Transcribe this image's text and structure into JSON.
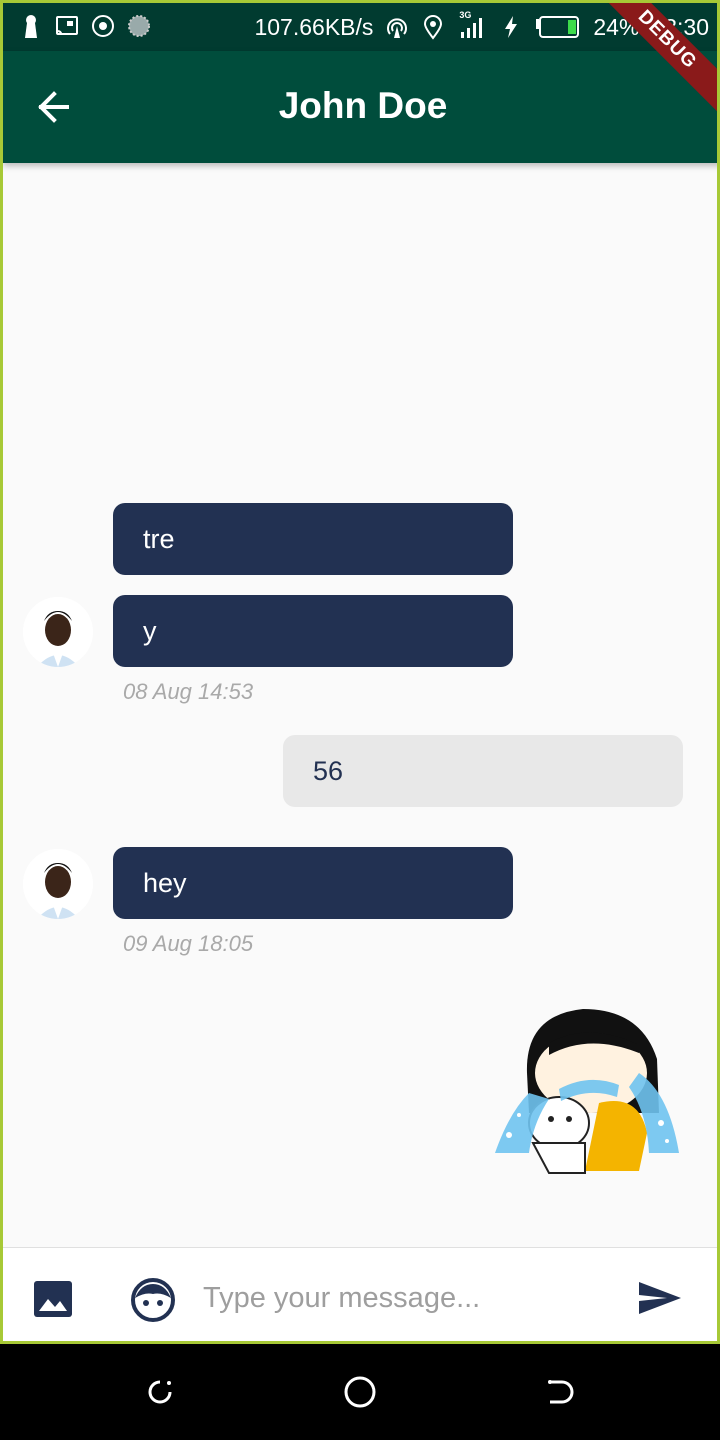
{
  "status_bar": {
    "net_speed": "107.66KB/s",
    "network_type": "3G",
    "battery": "24%",
    "time": "23:30",
    "icons": [
      "keyhole-icon",
      "screencast-icon",
      "target-icon",
      "loading-icon",
      "hotspot-icon",
      "location-icon",
      "signal-icon",
      "charging-icon",
      "battery-icon"
    ]
  },
  "app_bar": {
    "back_icon": "arrow-back-icon",
    "title": "John Doe",
    "debug_banner": "DEBUG"
  },
  "messages": [
    {
      "direction": "incoming",
      "text": "tre"
    },
    {
      "direction": "incoming",
      "text": "y",
      "timestamp": "08 Aug 14:53",
      "avatar": true
    },
    {
      "direction": "outgoing",
      "text": "56"
    },
    {
      "direction": "incoming",
      "text": "hey",
      "timestamp": "09 Aug 18:05",
      "avatar": true
    },
    {
      "direction": "outgoing",
      "type": "sticker",
      "sticker": "crying-girl-sticker"
    }
  ],
  "input_bar": {
    "image_icon": "image-icon",
    "emoji_icon": "face-icon",
    "placeholder": "Type your message...",
    "value": "",
    "send_icon": "send-icon"
  },
  "nav_bar": {
    "icons": [
      "recents-icon",
      "home-icon",
      "back-icon"
    ]
  },
  "colors": {
    "status_bar": "#013b30",
    "app_bar": "#004d3c",
    "incoming_bubble": "#223152",
    "outgoing_bubble": "#e8e8e8",
    "timestamp": "#a9a9a9",
    "frame_border": "#a7c936",
    "debug_ribbon": "#8a1a1a"
  }
}
